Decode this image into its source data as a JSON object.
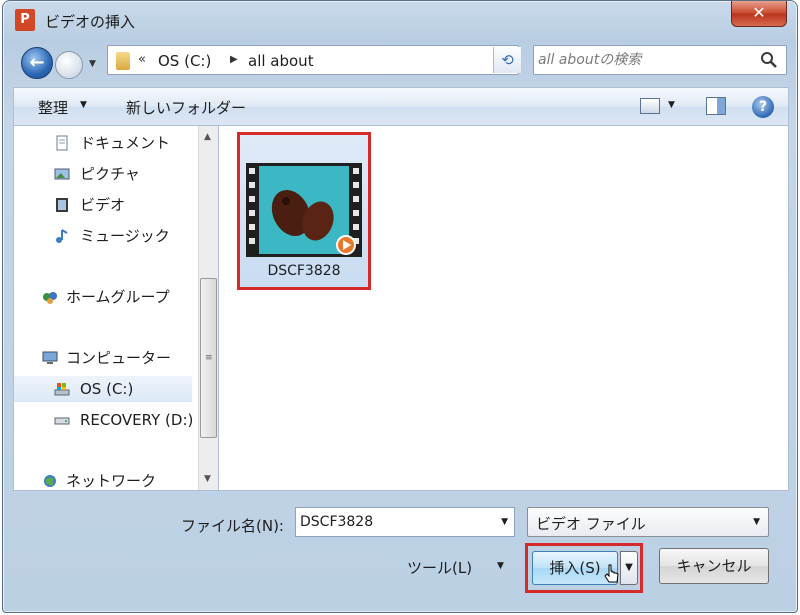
{
  "window": {
    "title": "ビデオの挿入",
    "app_icon_letter": "P",
    "close_glyph": "✕"
  },
  "nav": {
    "breadcrumb_chevron": "«",
    "breadcrumb": [
      "OS (C:)",
      "all about"
    ],
    "search_placeholder": "all aboutの検索"
  },
  "toolbar": {
    "organize_label": "整理",
    "new_folder_label": "新しいフォルダー",
    "help_glyph": "?"
  },
  "sidebar": {
    "items": [
      {
        "label": "ドキュメント",
        "icon": "document-icon"
      },
      {
        "label": "ピクチャ",
        "icon": "pictures-icon"
      },
      {
        "label": "ビデオ",
        "icon": "video-icon"
      },
      {
        "label": "ミュージック",
        "icon": "music-icon"
      },
      {
        "label": "ホームグループ",
        "icon": "homegroup-icon"
      },
      {
        "label": "コンピューター",
        "icon": "computer-icon"
      },
      {
        "label": "OS (C:)",
        "icon": "drive-c-icon",
        "selected": true
      },
      {
        "label": "RECOVERY (D:)",
        "icon": "drive-d-icon"
      },
      {
        "label": "ネットワーク",
        "icon": "network-icon"
      }
    ]
  },
  "files": [
    {
      "name": "DSCF3828",
      "type": "video",
      "selected": true
    }
  ],
  "footer": {
    "filename_label": "ファイル名(N):",
    "filename_value": "DSCF3828",
    "filetype_value": "ビデオ ファイル",
    "tools_label": "ツール(L)",
    "insert_label": "挿入(S)",
    "cancel_label": "キャンセル"
  },
  "colors": {
    "highlight_border": "#d42a2a",
    "selection_fill": "#c9dcf1",
    "primary_button": "#a7d7f5"
  }
}
